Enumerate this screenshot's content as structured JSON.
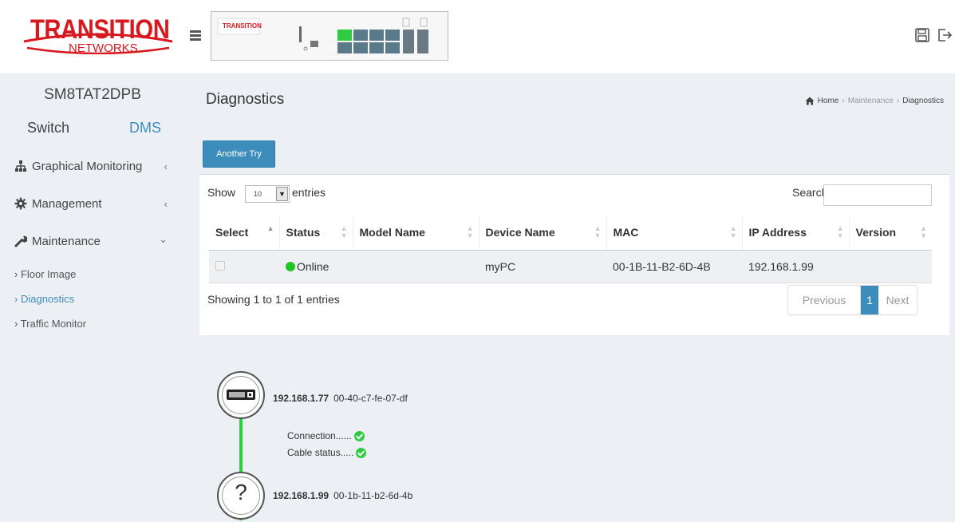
{
  "sidebar": {
    "logo_line1": "TRANSITION",
    "logo_line2": "NETWORKS.",
    "model": "SM8TAT2DPB",
    "mode_switch": "Switch",
    "mode_dms": "DMS",
    "items": [
      {
        "label": "Graphical Monitoring",
        "icon": "sitemap-icon",
        "arrow": "‹"
      },
      {
        "label": "Management",
        "icon": "gear-icon",
        "arrow": "‹"
      },
      {
        "label": "Maintenance",
        "icon": "wrench-icon",
        "arrow": "⌄"
      }
    ],
    "subitems": [
      {
        "label": "Floor Image"
      },
      {
        "label": "Diagnostics",
        "active": true
      },
      {
        "label": "Traffic Monitor"
      }
    ]
  },
  "topbar": {
    "device_brand": "TRANSITION",
    "save_icon": "save-icon",
    "logout_icon": "logout-icon"
  },
  "page": {
    "title": "Diagnostics",
    "breadcrumb": {
      "home": "Home",
      "sep": "›",
      "maintenance": "Maintenance",
      "current": "Diagnostics"
    },
    "another_try": "Another Try"
  },
  "table": {
    "show": "Show",
    "length": "10",
    "entries": "entries",
    "search": "Search:",
    "columns": [
      "Select",
      "Status",
      "Model Name",
      "Device Name",
      "MAC",
      "IP Address",
      "Version"
    ],
    "rows": [
      {
        "select": "",
        "status": "Online",
        "model_name": "",
        "device_name": "myPC",
        "mac": "00-1B-11-B2-6D-4B",
        "ip": "192.168.1.99",
        "version": ""
      }
    ],
    "info": "Showing 1 to 1 of 1 entries",
    "pager": {
      "previous": "Previous",
      "page": "1",
      "next": "Next"
    }
  },
  "diagram": {
    "switch_ip": "192.168.1.77",
    "switch_mac": "00-40-c7-fe-07-df",
    "connection_label": "Connection......",
    "cable_label": "Cable status.....",
    "device_ip": "192.168.1.99",
    "device_mac": "00-1b-11-b2-6d-4b",
    "unknown_glyph": "?"
  },
  "colors": {
    "accent": "#3c8dbc",
    "brand": "#d7191f",
    "ok": "#2ecc40",
    "online": "#21c521"
  }
}
